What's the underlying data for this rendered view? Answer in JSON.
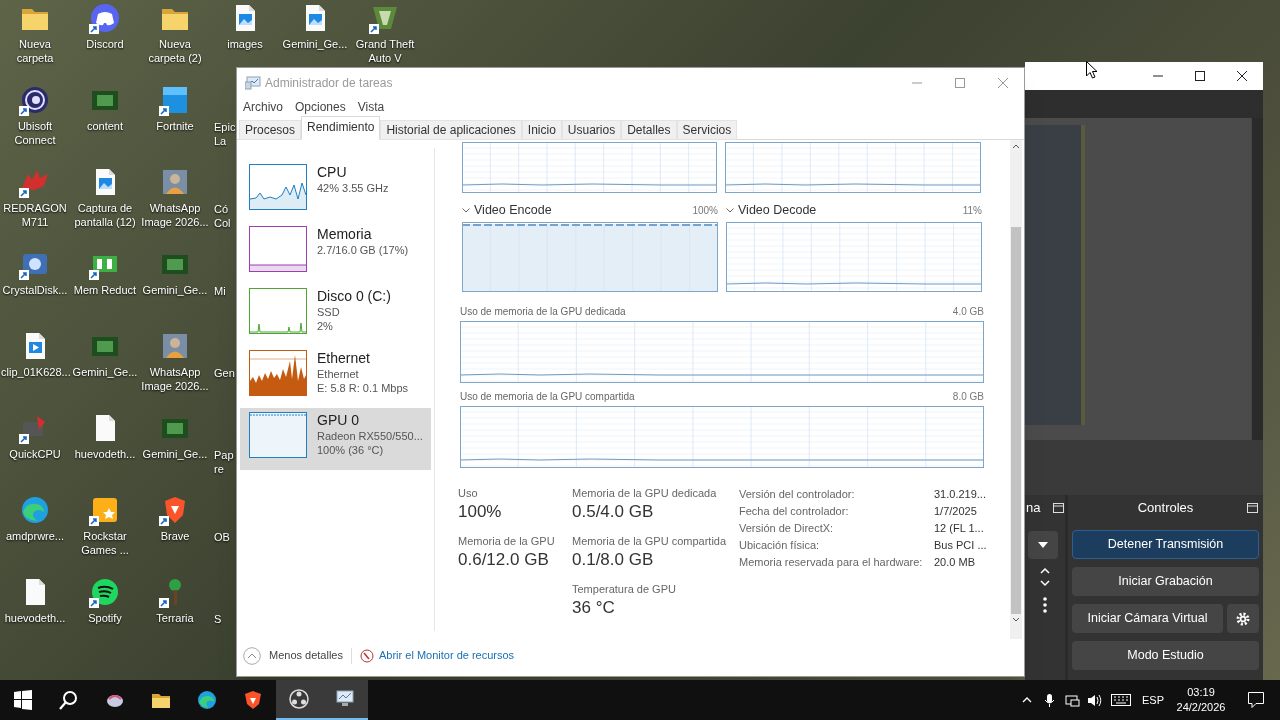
{
  "desktop": {
    "columns": [
      [
        {
          "label": "Nueva carpeta",
          "kind": "folder",
          "shortcut": false
        },
        {
          "label": "Ubisoft Connect",
          "kind": "ubisoft",
          "shortcut": true
        },
        {
          "label": "REDRAGON M711",
          "kind": "redragon",
          "shortcut": true
        },
        {
          "label": "CrystalDisk...",
          "kind": "crystal",
          "shortcut": true
        },
        {
          "label": "clip_01K628...",
          "kind": "video",
          "shortcut": false
        },
        {
          "label": "QuickCPU",
          "kind": "quickcpu",
          "shortcut": true
        },
        {
          "label": "amdprwre...",
          "kind": "edge",
          "shortcut": false
        },
        {
          "label": "huevodeth...",
          "kind": "file",
          "shortcut": false
        }
      ],
      [
        {
          "label": "Discord",
          "kind": "discord",
          "shortcut": true
        },
        {
          "label": "content",
          "kind": "gemini",
          "shortcut": false
        },
        {
          "label": "Captura de pantalla (12)",
          "kind": "image",
          "shortcut": false
        },
        {
          "label": "Mem Reduct",
          "kind": "memreduct",
          "shortcut": true
        },
        {
          "label": "Gemini_Ge...",
          "kind": "gemini",
          "shortcut": false
        },
        {
          "label": "huevodeth...",
          "kind": "file",
          "shortcut": false
        },
        {
          "label": "Rockstar Games ...",
          "kind": "rockstar",
          "shortcut": true
        },
        {
          "label": "Spotify",
          "kind": "spotify",
          "shortcut": true
        }
      ],
      [
        {
          "label": "Nueva carpeta (2)",
          "kind": "folder",
          "shortcut": false
        },
        {
          "label": "Fortnite",
          "kind": "fortnite",
          "shortcut": true
        },
        {
          "label": "WhatsApp Image 2026...",
          "kind": "photo",
          "shortcut": false
        },
        {
          "label": "Gemini_Ge...",
          "kind": "gemini",
          "shortcut": false
        },
        {
          "label": "WhatsApp Image 2026...",
          "kind": "photo",
          "shortcut": false
        },
        {
          "label": "Gemini_Ge...",
          "kind": "gemini",
          "shortcut": false
        },
        {
          "label": "Brave",
          "kind": "brave",
          "shortcut": true
        },
        {
          "label": "Terraria",
          "kind": "terraria",
          "shortcut": true
        }
      ],
      [
        {
          "label": "images",
          "kind": "image",
          "shortcut": false
        },
        {
          "label": "Epic La",
          "kind": "partial"
        },
        {
          "label": "Có Col",
          "kind": "partial"
        },
        {
          "label": "Mi",
          "kind": "partial"
        },
        {
          "label": "Gen",
          "kind": "partial"
        },
        {
          "label": "Pap re",
          "kind": "partial"
        },
        {
          "label": "OB",
          "kind": "partial"
        },
        {
          "label": "S",
          "kind": "partial"
        }
      ],
      [
        {
          "label": "Gemini_Ge...",
          "kind": "image",
          "shortcut": false
        }
      ],
      [
        {
          "label": "Grand Theft Auto V",
          "kind": "gta",
          "shortcut": true
        }
      ]
    ]
  },
  "task_manager": {
    "title": "Administrador de tareas",
    "menu": [
      "Archivo",
      "Opciones",
      "Vista"
    ],
    "tabs": [
      {
        "label": "Procesos",
        "selected": false
      },
      {
        "label": "Rendimiento",
        "selected": true
      },
      {
        "label": "Historial de aplicaciones",
        "selected": false
      },
      {
        "label": "Inicio",
        "selected": false
      },
      {
        "label": "Usuarios",
        "selected": false
      },
      {
        "label": "Detalles",
        "selected": false
      },
      {
        "label": "Servicios",
        "selected": false
      }
    ],
    "resources": [
      {
        "name": "CPU",
        "lines": [
          "42% 3.55 GHz"
        ],
        "color": "#1f7fc4",
        "kind": "spiky",
        "selected": false
      },
      {
        "name": "Memoria",
        "lines": [
          "2.7/16.0 GB (17%)"
        ],
        "color": "#9b3fb5",
        "kind": "flat",
        "selected": false
      },
      {
        "name": "Disco 0 (C:)",
        "lines": [
          "SSD",
          "2%"
        ],
        "color": "#4da633",
        "kind": "spikes",
        "selected": false
      },
      {
        "name": "Ethernet",
        "lines": [
          "Ethernet",
          "E: 5.8 R: 0.1 Mbps"
        ],
        "color": "#c55a11",
        "kind": "area",
        "selected": false
      },
      {
        "name": "GPU 0",
        "lines": [
          "Radeon RX550/550...",
          "100% (36 °C)"
        ],
        "color": "#1f7fc4",
        "kind": "empty",
        "selected": true
      }
    ],
    "engine_graphs": [
      {
        "label": "Video Encode",
        "reading": "100%",
        "kind": "full"
      },
      {
        "label": "Video Decode",
        "reading": "11%",
        "kind": "low"
      }
    ],
    "memory_graphs": [
      {
        "label": "Uso de memoria de la GPU dedicada",
        "max": "4.0 GB"
      },
      {
        "label": "Uso de memoria de la GPU compartida",
        "max": "8.0 GB"
      }
    ],
    "stats": [
      [
        {
          "label": "Uso",
          "value": "100%"
        },
        {
          "label": "Memoria de la GPU",
          "value": "0.6/12.0 GB"
        }
      ],
      [
        {
          "label": "Memoria de la GPU dedicada",
          "value": "0.5/4.0 GB"
        },
        {
          "label": "Memoria de la GPU compartida",
          "value": "0.1/8.0 GB"
        },
        {
          "label": "Temperatura de GPU",
          "value": "36 °C"
        }
      ]
    ],
    "properties": [
      {
        "key": "Versión del controlador:",
        "value": "31.0.219..."
      },
      {
        "key": "Fecha del controlador:",
        "value": "1/7/2025"
      },
      {
        "key": "Versión de DirectX:",
        "value": "12 (FL 1..."
      },
      {
        "key": "Ubicación física:",
        "value": "Bus PCI ..."
      },
      {
        "key": "Memoria reservada para el hardware:",
        "value": "20.0 MB"
      }
    ],
    "footer": {
      "less_details": "Menos detalles",
      "monitor_link": "Abrir el Monitor de recursos"
    }
  },
  "second_window": {
    "left_dock_title": "na",
    "controls_title": "Controles",
    "buttons": [
      {
        "label": "Detener Transmisión",
        "active": true,
        "has_settings": false
      },
      {
        "label": "Iniciar Grabación",
        "active": false,
        "has_settings": false
      },
      {
        "label": "Iniciar Cámara Virtual",
        "active": false,
        "has_settings": true
      },
      {
        "label": "Modo Estudio",
        "active": false,
        "has_settings": false
      }
    ]
  },
  "taskbar": {
    "apps": [
      {
        "kind": "start",
        "active": false
      },
      {
        "kind": "search",
        "active": false
      },
      {
        "kind": "mouse",
        "active": false
      },
      {
        "kind": "folder",
        "active": false
      },
      {
        "kind": "edge",
        "active": false
      },
      {
        "kind": "brave",
        "active": false
      },
      {
        "kind": "obs",
        "active": true
      },
      {
        "kind": "taskmgr",
        "active": true
      }
    ],
    "language": "ESP",
    "time": "03:19",
    "date": "24/2/2026"
  }
}
